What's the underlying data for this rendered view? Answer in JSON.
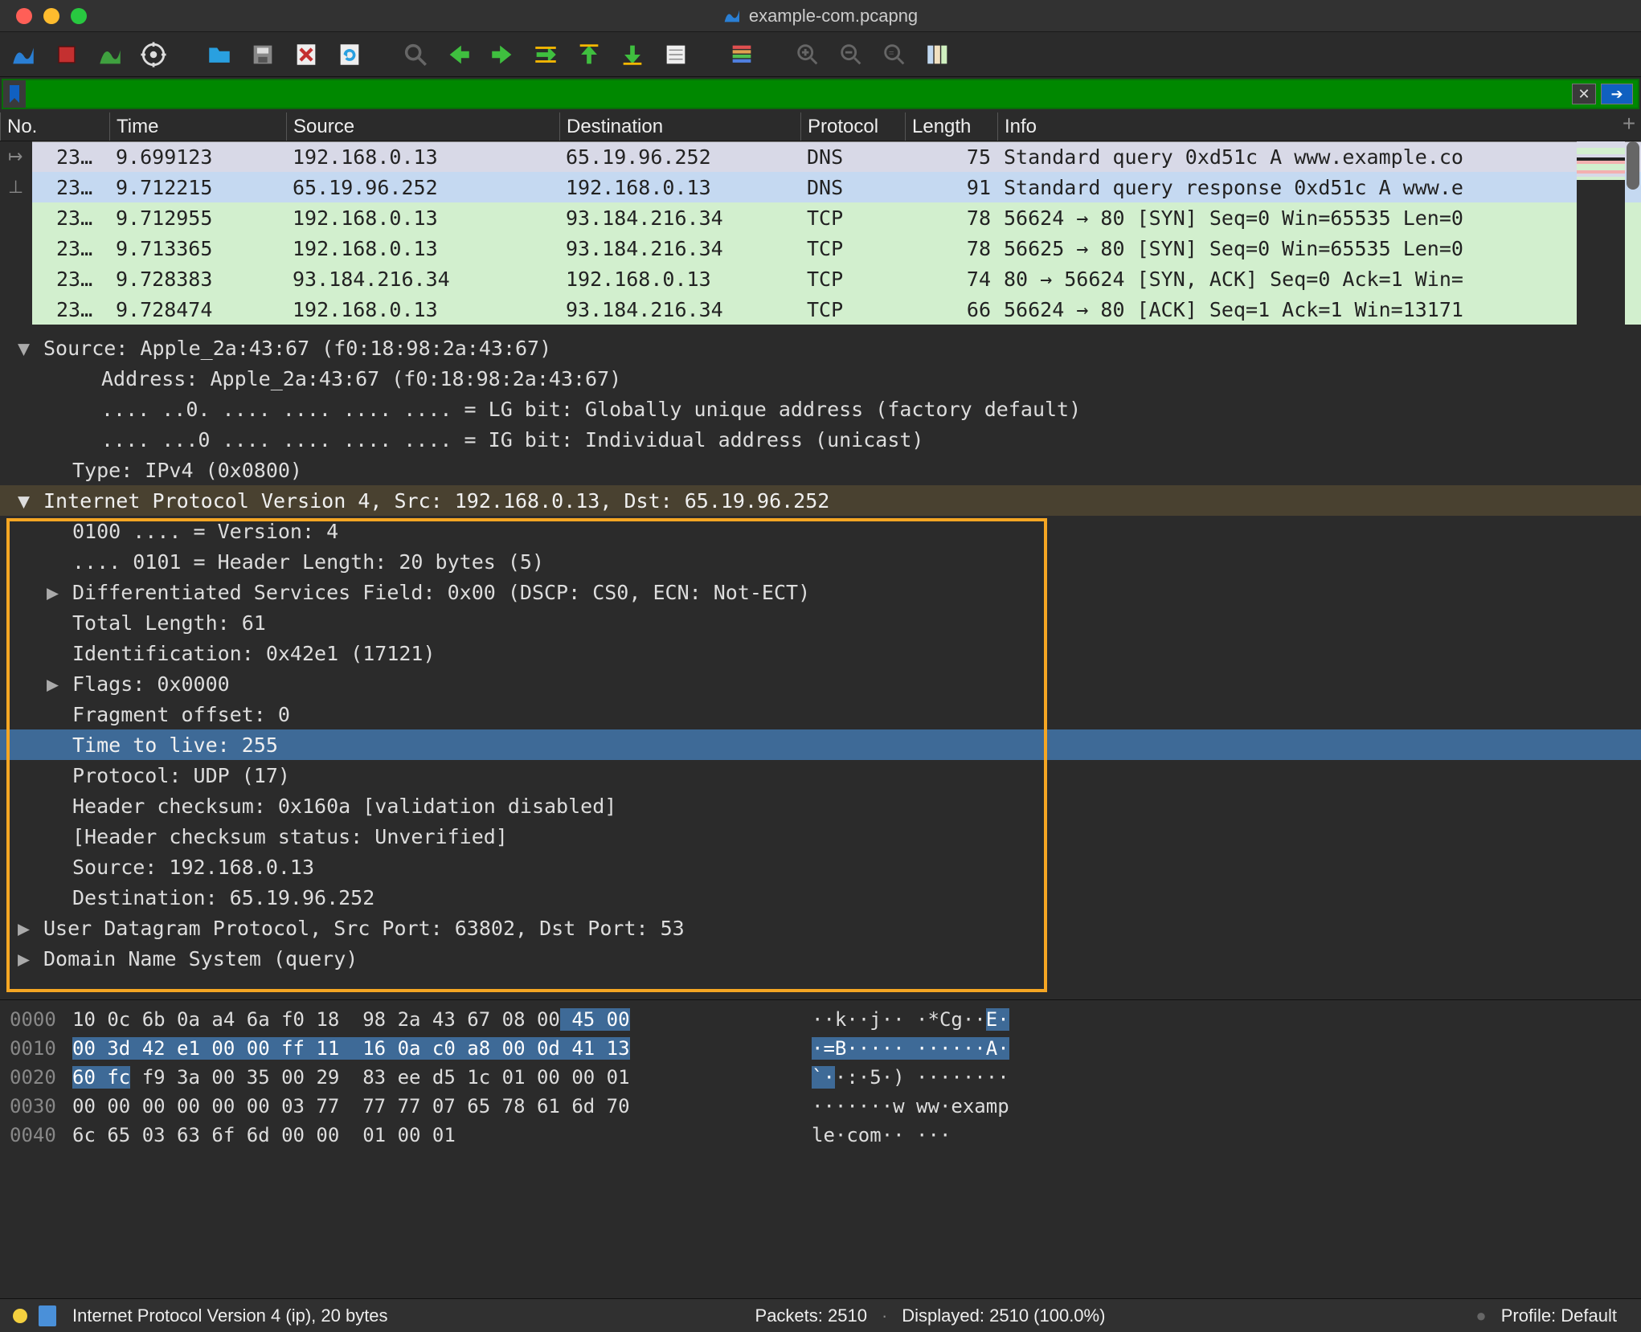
{
  "window": {
    "title": "example-com.pcapng"
  },
  "filter": {
    "value": "",
    "placeholder": ""
  },
  "columns": {
    "no": "No.",
    "time": "Time",
    "source": "Source",
    "destination": "Destination",
    "protocol": "Protocol",
    "length": "Length",
    "info": "Info"
  },
  "packets": [
    {
      "no": "23…",
      "time": "9.699123",
      "src": "192.168.0.13",
      "dst": "65.19.96.252",
      "proto": "DNS",
      "len": "75",
      "info": "Standard query 0xd51c A www.example.co"
    },
    {
      "no": "23…",
      "time": "9.712215",
      "src": "65.19.96.252",
      "dst": "192.168.0.13",
      "proto": "DNS",
      "len": "91",
      "info": "Standard query response 0xd51c A www.e"
    },
    {
      "no": "23…",
      "time": "9.712955",
      "src": "192.168.0.13",
      "dst": "93.184.216.34",
      "proto": "TCP",
      "len": "78",
      "info": "56624 → 80 [SYN] Seq=0 Win=65535 Len=0"
    },
    {
      "no": "23…",
      "time": "9.713365",
      "src": "192.168.0.13",
      "dst": "93.184.216.34",
      "proto": "TCP",
      "len": "78",
      "info": "56625 → 80 [SYN] Seq=0 Win=65535 Len=0"
    },
    {
      "no": "23…",
      "time": "9.728383",
      "src": "93.184.216.34",
      "dst": "192.168.0.13",
      "proto": "TCP",
      "len": "74",
      "info": "80 → 56624 [SYN, ACK] Seq=0 Ack=1 Win="
    },
    {
      "no": "23…",
      "time": "9.728474",
      "src": "192.168.0.13",
      "dst": "93.184.216.34",
      "proto": "TCP",
      "len": "66",
      "info": "56624 → 80 [ACK] Seq=1 Ack=1 Win=13171"
    }
  ],
  "details": {
    "eth": {
      "source": "Source: Apple_2a:43:67 (f0:18:98:2a:43:67)",
      "address": "Address: Apple_2a:43:67 (f0:18:98:2a:43:67)",
      "lgbit": ".... ..0. .... .... .... .... = LG bit: Globally unique address (factory default)",
      "igbit": ".... ...0 .... .... .... .... = IG bit: Individual address (unicast)",
      "type": "Type: IPv4 (0x0800)"
    },
    "ipv4": {
      "header": "Internet Protocol Version 4, Src: 192.168.0.13, Dst: 65.19.96.252",
      "version": "0100 .... = Version: 4",
      "hlen": ".... 0101 = Header Length: 20 bytes (5)",
      "dsf": "Differentiated Services Field: 0x00 (DSCP: CS0, ECN: Not-ECT)",
      "totlen": "Total Length: 61",
      "ident": "Identification: 0x42e1 (17121)",
      "flags": "Flags: 0x0000",
      "fragoff": "Fragment offset: 0",
      "ttl": "Time to live: 255",
      "proto": "Protocol: UDP (17)",
      "cksum": "Header checksum: 0x160a [validation disabled]",
      "cksumstat": "[Header checksum status: Unverified]",
      "src": "Source: 192.168.0.13",
      "dst": "Destination: 65.19.96.252"
    },
    "udp": "User Datagram Protocol, Src Port: 63802, Dst Port: 53",
    "dns": "Domain Name System (query)"
  },
  "bytes": {
    "rows": [
      {
        "off": "0000",
        "hex": "10 0c 6b 0a a4 6a f0 18  98 2a 43 67 08 00 45 00",
        "ascii": "··k··j·· ·*Cg··E·",
        "hl_hex_start": 42,
        "hl_ascii_start": 15
      },
      {
        "off": "0010",
        "hex": "00 3d 42 e1 00 00 ff 11  16 0a c0 a8 00 0d 41 13",
        "ascii": "·=B····· ······A·",
        "hl_hex_start": 0,
        "hl_ascii_start": 0
      },
      {
        "off": "0020",
        "hex": "60 fc f9 3a 00 35 00 29  83 ee d5 1c 01 00 00 01",
        "ascii": "`··:·5·) ········",
        "hl_hex_start": 0,
        "hl_hex_end": 5,
        "hl_ascii_start": 0,
        "hl_ascii_end": 2
      },
      {
        "off": "0030",
        "hex": "00 00 00 00 00 00 03 77  77 77 07 65 78 61 6d 70",
        "ascii": "·······w ww·examp"
      },
      {
        "off": "0040",
        "hex": "6c 65 03 63 6f 6d 00 00  01 00 01",
        "ascii": "le·com·· ···"
      }
    ]
  },
  "status": {
    "field": "Internet Protocol Version 4 (ip), 20 bytes",
    "packets": "Packets: 2510",
    "displayed": "Displayed: 2510 (100.0%)",
    "profile": "Profile: Default"
  }
}
